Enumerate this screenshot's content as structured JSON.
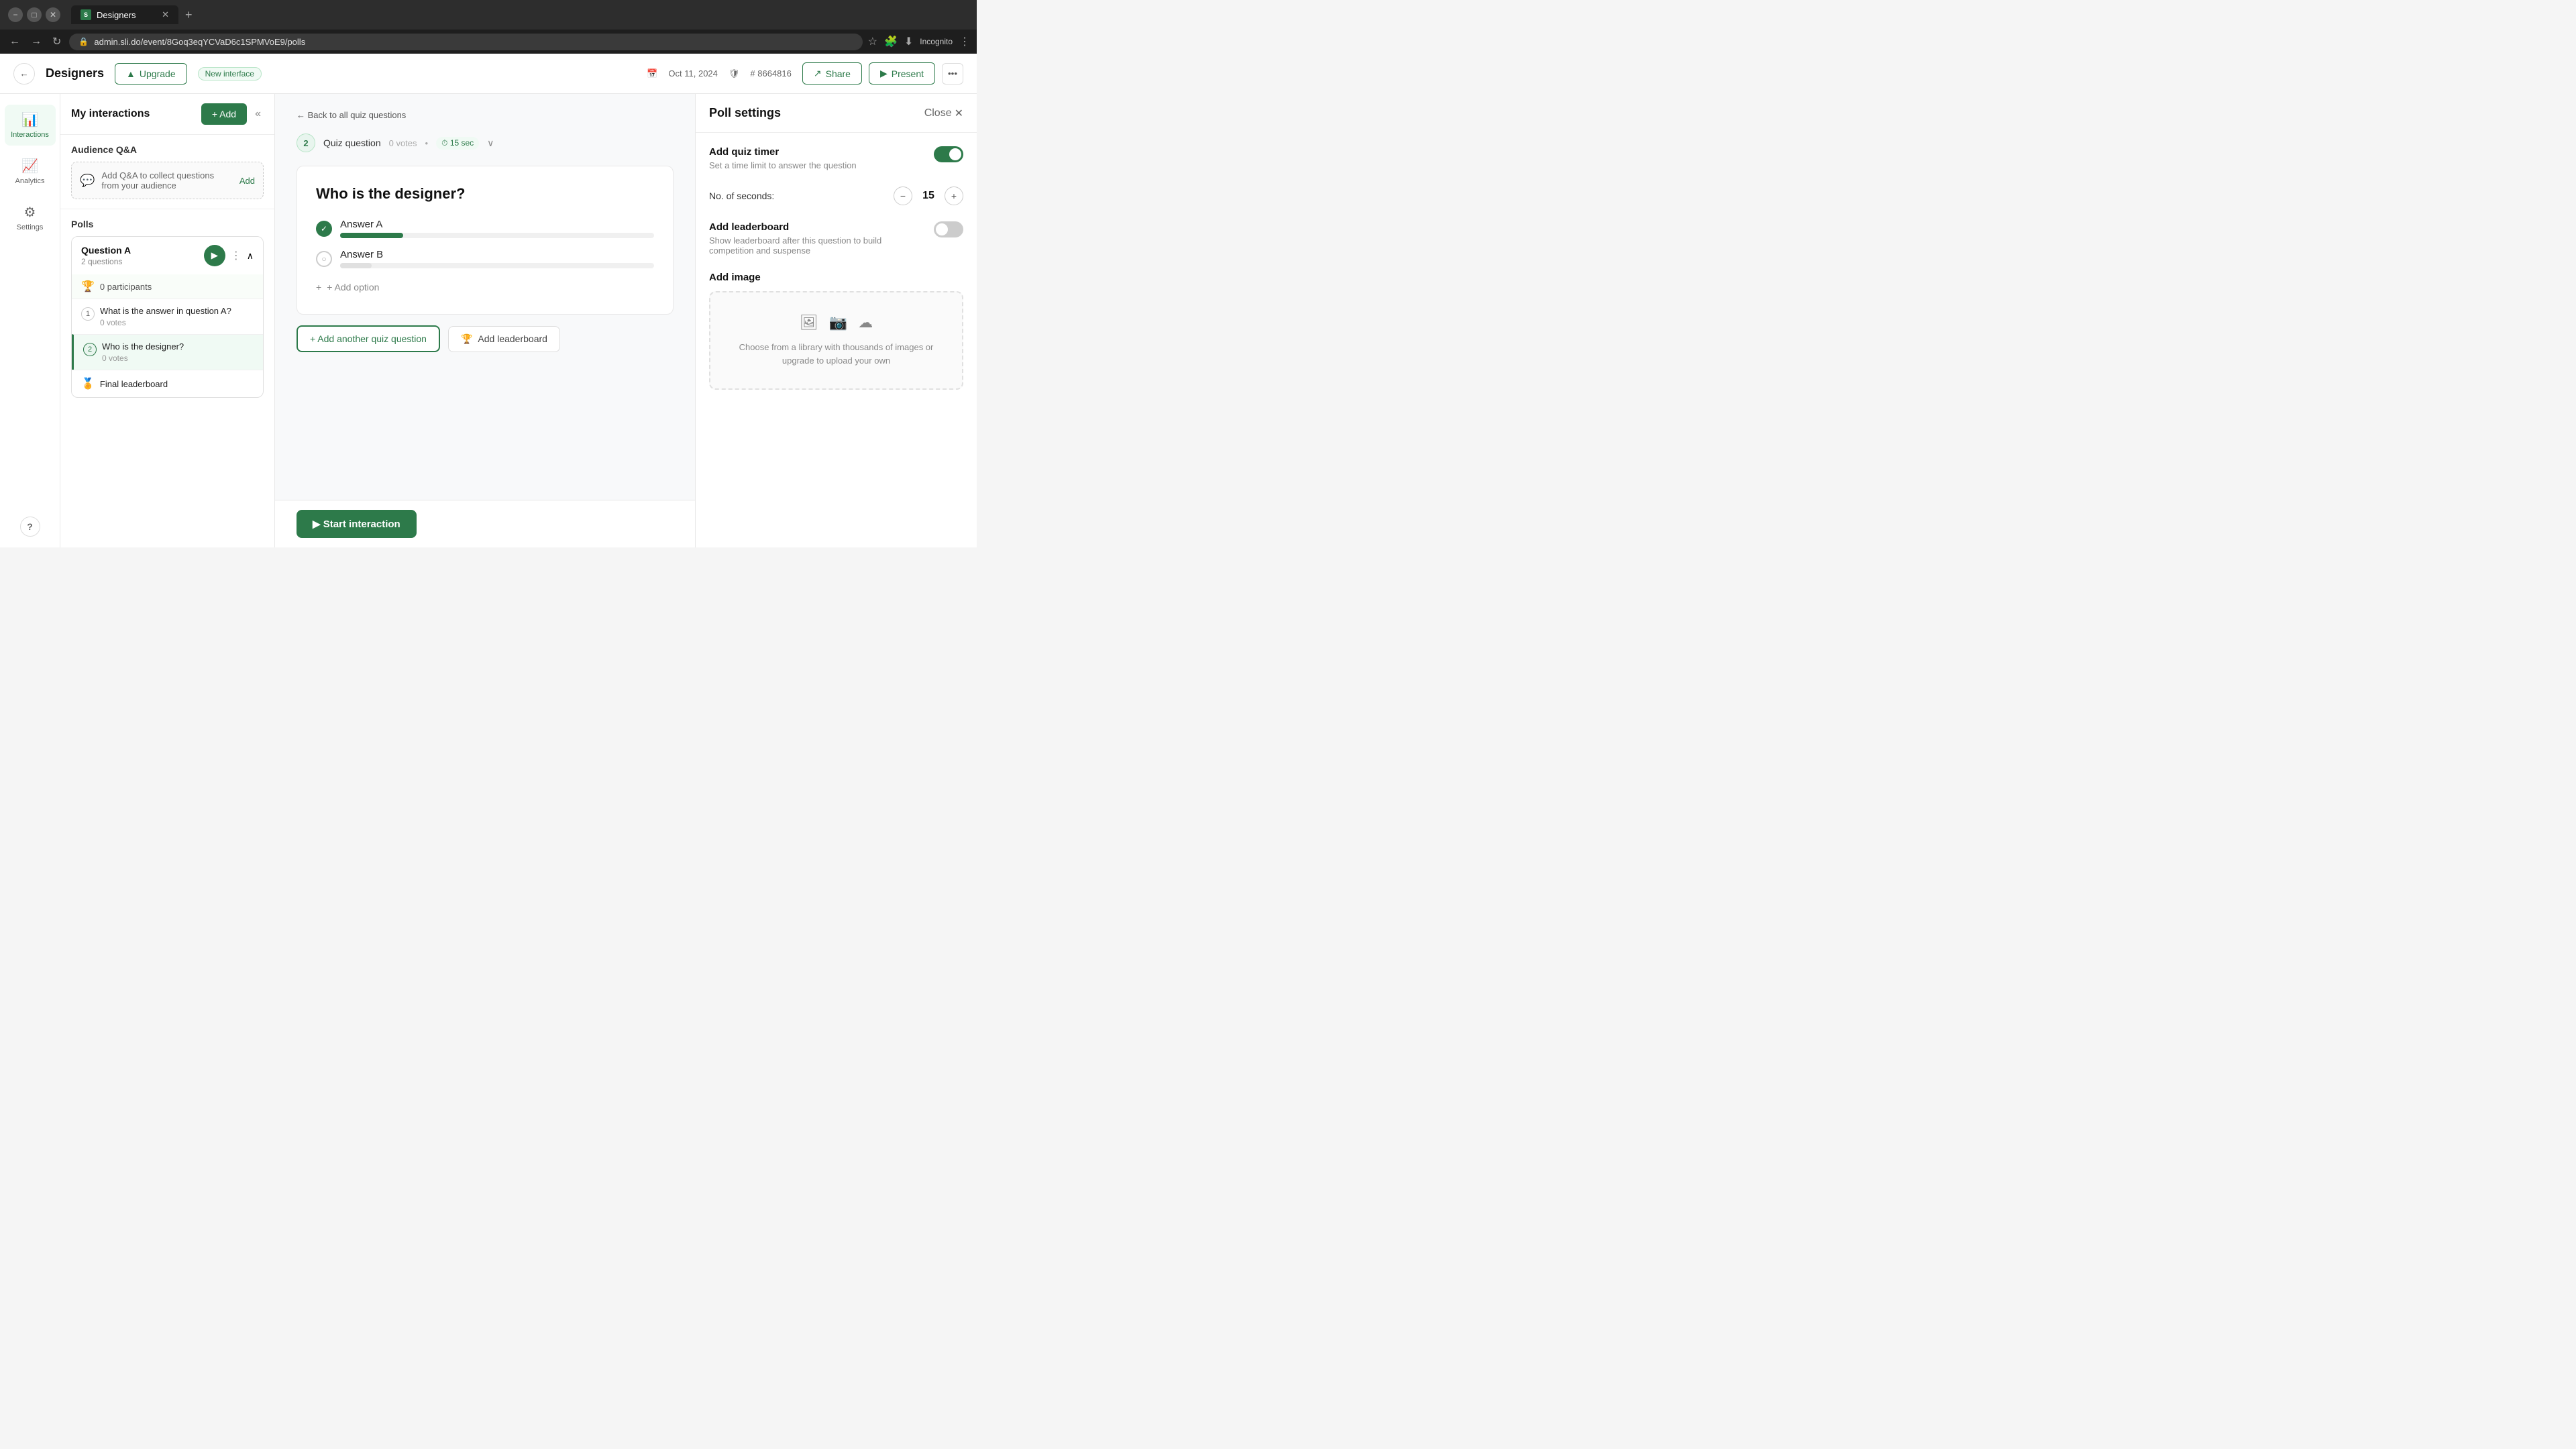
{
  "browser": {
    "url": "admin.sli.do/event/8Goq3eqYCVaD6c1SPMVoE9/polls",
    "tab_title": "Designers",
    "tab_favicon": "S"
  },
  "header": {
    "back_label": "←",
    "title": "Designers",
    "upgrade_label": "Upgrade",
    "new_interface_label": "New interface",
    "date": "Oct 11, 2024",
    "event_id": "# 8664816",
    "share_label": "Share",
    "present_label": "Present",
    "more_label": "..."
  },
  "side_nav": {
    "interactions_label": "Interactions",
    "analytics_label": "Analytics",
    "settings_label": "Settings",
    "help_label": "?"
  },
  "interactions_panel": {
    "title": "My interactions",
    "add_label": "+ Add",
    "collapse_label": "«",
    "qa_section_title": "Audience Q&A",
    "qa_card_text": "Add Q&A to collect questions from your audience",
    "qa_add_label": "Add",
    "polls_section_title": "Polls",
    "poll_group_name": "Question A",
    "poll_group_count": "2 questions",
    "poll_participants": "0 participants",
    "questions": [
      {
        "num": "1",
        "text": "What is the answer in question A?",
        "votes": "0 votes",
        "selected": false
      },
      {
        "num": "2",
        "text": "Who is the designer?",
        "votes": "0 votes",
        "selected": true
      }
    ],
    "leaderboard_label": "Final leaderboard"
  },
  "content": {
    "back_link_label": "← Back to all quiz questions",
    "quiz_num": "2",
    "quiz_type_label": "Quiz question",
    "quiz_votes": "0 votes",
    "quiz_timer": "15 sec",
    "question_text": "Who is the designer?",
    "answers": [
      {
        "label": "Answer A",
        "correct": true,
        "bar_width": "20"
      },
      {
        "label": "Answer B",
        "correct": false,
        "bar_width": "10"
      }
    ],
    "add_option_label": "+ Add option",
    "add_quiz_question_label": "+ Add another quiz question",
    "add_leaderboard_label": "Add leaderboard",
    "start_label": "▶ Start interaction"
  },
  "poll_settings": {
    "title": "Poll settings",
    "close_label": "Close",
    "add_timer_label": "Add quiz timer",
    "add_timer_desc": "Set a time limit to answer the question",
    "timer_enabled": true,
    "no_of_seconds_label": "No. of seconds:",
    "seconds_value": "15",
    "decrement_label": "−",
    "increment_label": "+",
    "add_leaderboard_label": "Add leaderboard",
    "add_leaderboard_desc": "Show leaderboard after this question to build competition and suspense",
    "leaderboard_enabled": false,
    "add_image_label": "Add image",
    "upload_text": "Choose from a library with thousands of images or upgrade to upload your own"
  }
}
